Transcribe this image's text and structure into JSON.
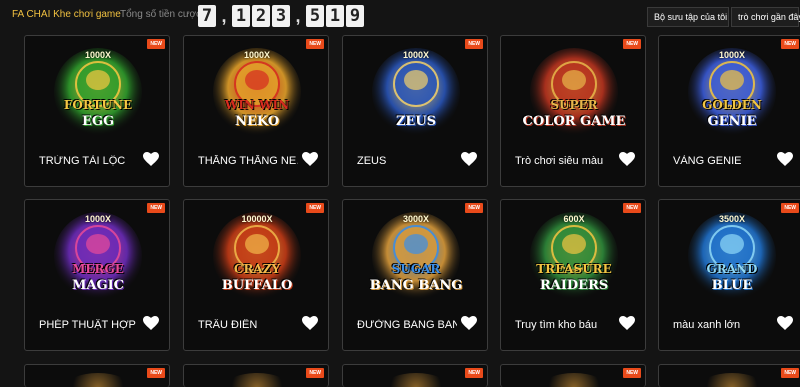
{
  "header": {
    "brand": "FA CHAI Khe chơi game",
    "subtitle": "Tổng số tiền cược",
    "jackpot_digits": [
      "7",
      ",",
      "1",
      "2",
      "3",
      ",",
      "5",
      "1",
      "9"
    ],
    "sort_dropdown": "Bộ sưu tập của tôi ⇓",
    "recent_dropdown": "trò chơi gần đây"
  },
  "badge_label": "NEW",
  "games": [
    {
      "name": "TRỨNG TÀI LỘC",
      "multiplier": "1000X",
      "art_line1": "FORTUNE",
      "art_line2": "EGG",
      "colors": [
        "#2f9d2c",
        "#f5c842"
      ]
    },
    {
      "name": "THẮNG THẮNG NE…",
      "multiplier": "1000X",
      "art_line1": "WIN WIN",
      "art_line2": "NEKO",
      "colors": [
        "#e3a12a",
        "#d62b1f"
      ]
    },
    {
      "name": "ZEUS",
      "multiplier": "1000X",
      "art_line1": "",
      "art_line2": "ZEUS",
      "colors": [
        "#2955b8",
        "#f2d06b"
      ]
    },
    {
      "name": "Trò chơi siêu màu",
      "multiplier": "",
      "art_line1": "SUPER",
      "art_line2": "COLOR GAME",
      "colors": [
        "#b8331f",
        "#e8b64a"
      ]
    },
    {
      "name": "VÀNG GENIE",
      "multiplier": "1000X",
      "art_line1": "GOLDEN",
      "art_line2": "GENIE",
      "colors": [
        "#3a5bd8",
        "#f2c542"
      ]
    },
    {
      "name": "PHÉP THUẬT HỢP …",
      "multiplier": "1000X",
      "art_line1": "MERGE",
      "art_line2": "MAGIC",
      "colors": [
        "#6a2bb8",
        "#e84a9a"
      ]
    },
    {
      "name": "TRÂU ĐIÊN",
      "multiplier": "10000X",
      "art_line1": "CRAZY",
      "art_line2": "BUFFALO",
      "colors": [
        "#c23a16",
        "#f2b84a"
      ]
    },
    {
      "name": "ĐƯỜNG BANG BANG",
      "multiplier": "3000X",
      "art_line1": "SUGAR",
      "art_line2": "BANG BANG",
      "colors": [
        "#d99a3a",
        "#3a8ee8"
      ]
    },
    {
      "name": "Truy tìm kho báu",
      "multiplier": "600X",
      "art_line1": "TREASURE",
      "art_line2": "RAIDERS",
      "colors": [
        "#2e8a3a",
        "#f2c542"
      ]
    },
    {
      "name": "màu xanh lớn",
      "multiplier": "3500X",
      "art_line1": "GRAND",
      "art_line2": "BLUE",
      "colors": [
        "#1f6fc8",
        "#8ed8f8"
      ]
    }
  ]
}
